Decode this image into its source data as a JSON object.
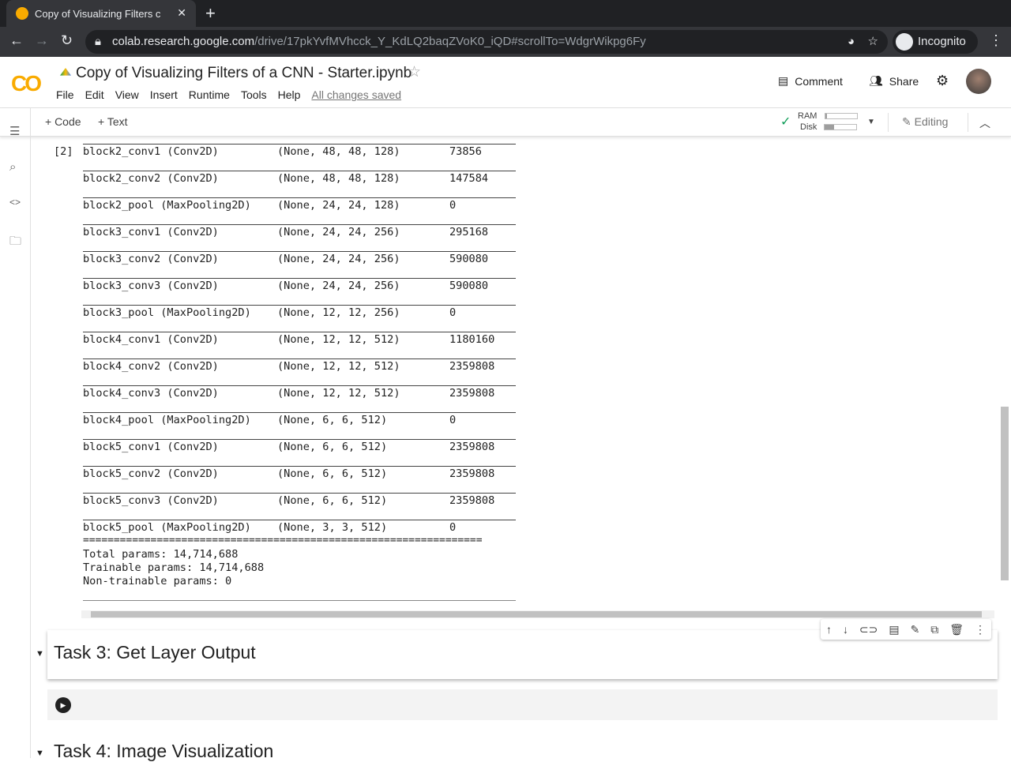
{
  "browser": {
    "tab_title": "Copy of Visualizing Filters c",
    "url_host": "colab.research.google.com",
    "url_path": "/drive/17pkYvfMVhcck_Y_KdLQ2baqZVoK0_iQD#scrollTo=WdgrWikpg6Fy",
    "incognito": "Incognito"
  },
  "header": {
    "title": "Copy of Visualizing Filters of a CNN - Starter.ipynb",
    "menu": [
      "File",
      "Edit",
      "View",
      "Insert",
      "Runtime",
      "Tools",
      "Help"
    ],
    "saved": "All changes saved",
    "comment": "Comment",
    "share": "Share"
  },
  "toolbar": {
    "code": "+ Code",
    "text": "+ Text",
    "ram": "RAM",
    "disk": "Disk",
    "ram_usage": 0.05,
    "disk_usage": 0.3,
    "editing": "Editing"
  },
  "cell": {
    "exec_count": "[2]",
    "rows": [
      [
        "block2_conv1 (Conv2D)",
        "(None, 48, 48, 128)",
        "73856"
      ],
      [
        "block2_conv2 (Conv2D)",
        "(None, 48, 48, 128)",
        "147584"
      ],
      [
        "block2_pool (MaxPooling2D)",
        "(None, 24, 24, 128)",
        "0"
      ],
      [
        "block3_conv1 (Conv2D)",
        "(None, 24, 24, 256)",
        "295168"
      ],
      [
        "block3_conv2 (Conv2D)",
        "(None, 24, 24, 256)",
        "590080"
      ],
      [
        "block3_conv3 (Conv2D)",
        "(None, 24, 24, 256)",
        "590080"
      ],
      [
        "block3_pool (MaxPooling2D)",
        "(None, 12, 12, 256)",
        "0"
      ],
      [
        "block4_conv1 (Conv2D)",
        "(None, 12, 12, 512)",
        "1180160"
      ],
      [
        "block4_conv2 (Conv2D)",
        "(None, 12, 12, 512)",
        "2359808"
      ],
      [
        "block4_conv3 (Conv2D)",
        "(None, 12, 12, 512)",
        "2359808"
      ],
      [
        "block4_pool (MaxPooling2D)",
        "(None, 6, 6, 512)",
        "0"
      ],
      [
        "block5_conv1 (Conv2D)",
        "(None, 6, 6, 512)",
        "2359808"
      ],
      [
        "block5_conv2 (Conv2D)",
        "(None, 6, 6, 512)",
        "2359808"
      ],
      [
        "block5_conv3 (Conv2D)",
        "(None, 6, 6, 512)",
        "2359808"
      ],
      [
        "block5_pool (MaxPooling2D)",
        "(None, 3, 3, 512)",
        "0"
      ]
    ],
    "separator": "=================================================================",
    "total": "Total params: 14,714,688",
    "trainable": "Trainable params: 14,714,688",
    "non_trainable": "Non-trainable params: 0"
  },
  "sections": {
    "task3": "Task 3: Get Layer Output",
    "task4": "Task 4: Image Visualization"
  }
}
